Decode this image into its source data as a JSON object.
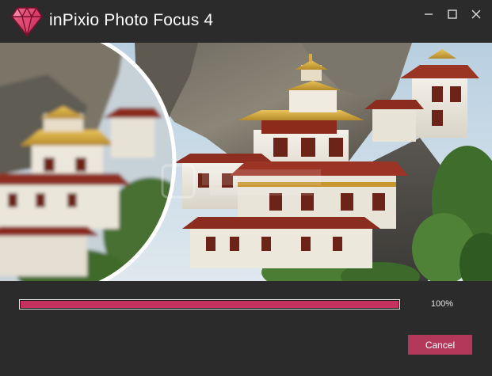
{
  "window": {
    "title": "inPixio Photo Focus 4",
    "controls": [
      "minimize",
      "maximize",
      "close"
    ]
  },
  "banner": {
    "image": "photo of a cliffside monastery with a circular blurred/sharp focus comparison",
    "icon": "photo-focus-banner"
  },
  "progress": {
    "value": 1.0,
    "label": "100%"
  },
  "actions": {
    "cancel_label": "Cancel"
  },
  "colors": {
    "background": "#2b2b2b",
    "accent": "#c5325f",
    "button": "#b2385a",
    "text": "#ffffff"
  }
}
